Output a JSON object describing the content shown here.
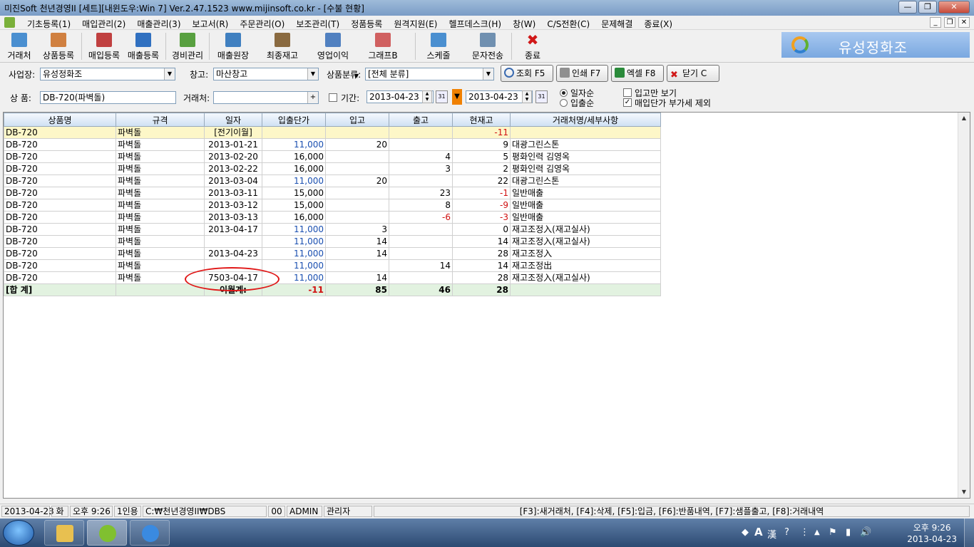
{
  "window": {
    "title": "미진Soft 천년경영II [세트][내윈도우:Win 7] Ver.2.47.1523            www.mijinsoft.co.kr - [수불 현황]",
    "min_label": "—",
    "max_label": "❐",
    "close_label": "✕"
  },
  "menu": {
    "items": [
      "기초등록(1)",
      "매입관리(2)",
      "매출관리(3)",
      "보고서(R)",
      "주문관리(O)",
      "보조관리(T)",
      "정품등록",
      "원격지원(E)",
      "헬프데스크(H)",
      "창(W)",
      "C/S전환(C)",
      "문제해결",
      "종료(X)"
    ],
    "mdi_min": "_",
    "mdi_restore": "❐",
    "mdi_close": "✕"
  },
  "toolbar": {
    "buttons": [
      "거래처",
      "상품등록",
      "매입등록",
      "매출등록",
      "경비관리",
      "매출원장",
      "최종재고",
      "영업이익",
      "그래프B",
      "스케줄",
      "문자전송",
      "종료"
    ],
    "dropdown_glyph": "▼",
    "colors": [
      "#4a8fd0",
      "#d08040",
      "#c04040",
      "#3070c0",
      "#58a040",
      "#4080c0",
      "#8a6a40",
      "#5080c0",
      "#d06060",
      "#4a8fd0",
      "#7090b0",
      "#d01818"
    ]
  },
  "brand": {
    "name": "유성정화조"
  },
  "filters": {
    "business_label": "사업장:",
    "business_value": "유성정화조",
    "warehouse_label": "창고:",
    "warehouse_value": "마산창고",
    "category_label": "상품분류:",
    "category_value": "[전체 분류]",
    "product_label": "상  품:",
    "product_value": "DB-720(파벽돌)",
    "client_label": "거래처:",
    "client_value": "",
    "client_plus": "+",
    "period_label": "기간:",
    "date_from": "2013-04-23",
    "date_to": "2013-04-23",
    "calendar_glyph": "31",
    "order_by_date": "일자순",
    "order_by_io": "입출순",
    "only_receipts": "입고만 보기",
    "exclude_vat": "매입단가 부가세 제외",
    "check_glyph": "✓",
    "combo_arrow": "▼",
    "spin_up": "▲",
    "spin_down": "▼"
  },
  "actions": {
    "search": "조회 F5",
    "print": "인쇄 F7",
    "excel": "엑셀 F8",
    "close": "닫기 C"
  },
  "grid": {
    "headers": [
      "상품명",
      "규격",
      "일자",
      "입출단가",
      "입고",
      "출고",
      "현재고",
      "거래처명/세부사항"
    ],
    "rows": [
      [
        "DB-720",
        "파벽돌",
        "[전기이월]",
        "",
        "",
        "",
        "-11",
        ""
      ],
      [
        "DB-720",
        "파벽돌",
        "2013-01-21",
        "11,000",
        "20",
        "",
        "9",
        "대광그린스톤"
      ],
      [
        "DB-720",
        "파벽돌",
        "2013-02-20",
        "16,000",
        "",
        "4",
        "5",
        "평화인력 김영옥"
      ],
      [
        "DB-720",
        "파벽돌",
        "2013-02-22",
        "16,000",
        "",
        "3",
        "2",
        "평화인력 김영옥"
      ],
      [
        "DB-720",
        "파벽돌",
        "2013-03-04",
        "11,000",
        "20",
        "",
        "22",
        "대광그린스톤"
      ],
      [
        "DB-720",
        "파벽돌",
        "2013-03-11",
        "15,000",
        "",
        "23",
        "-1",
        "일반매출"
      ],
      [
        "DB-720",
        "파벽돌",
        "2013-03-12",
        "15,000",
        "",
        "8",
        "-9",
        "일반매출"
      ],
      [
        "DB-720",
        "파벽돌",
        "2013-03-13",
        "16,000",
        "",
        "-6",
        "-3",
        "일반매출"
      ],
      [
        "DB-720",
        "파벽돌",
        "2013-04-17",
        "11,000",
        "3",
        "",
        "0",
        "재고조정入(재고실사)"
      ],
      [
        "DB-720",
        "파벽돌",
        "",
        "11,000",
        "14",
        "",
        "14",
        "재고조정入(재고실사)"
      ],
      [
        "DB-720",
        "파벽돌",
        "2013-04-23",
        "11,000",
        "14",
        "",
        "28",
        "재고조정入"
      ],
      [
        "DB-720",
        "파벽돌",
        "",
        "11,000",
        "",
        "14",
        "14",
        "재고조정出"
      ],
      [
        "DB-720",
        "파벽돌",
        "7503-04-17",
        "11,000",
        "14",
        "",
        "28",
        "재고조정入(재고실사)"
      ]
    ],
    "total": [
      "[합 계]",
      "",
      "이월계:",
      "-11",
      "85",
      "46",
      "28",
      ""
    ],
    "scroll_up": "▲",
    "scroll_down": "▼"
  },
  "status": {
    "date": "2013-04-23",
    "weekday": "화",
    "time": "오후 9:26",
    "users": "1인용",
    "path": "C:₩천년경영II₩DBS",
    "code": "00",
    "user": "ADMIN",
    "role": "관리자",
    "shortcuts": "[F3]:새거래처, [F4]:삭제, [F5]:입금, [F6]:반품내역, [F7]:샘플출고, [F8]:거래내역"
  },
  "taskbar": {
    "tray_icons": [
      "◆",
      "A",
      "漢",
      "?",
      "⋮",
      "▲",
      "⚑",
      "▮",
      "🔊"
    ],
    "clock_time": "오후 9:26",
    "clock_date": "2013-04-23"
  }
}
